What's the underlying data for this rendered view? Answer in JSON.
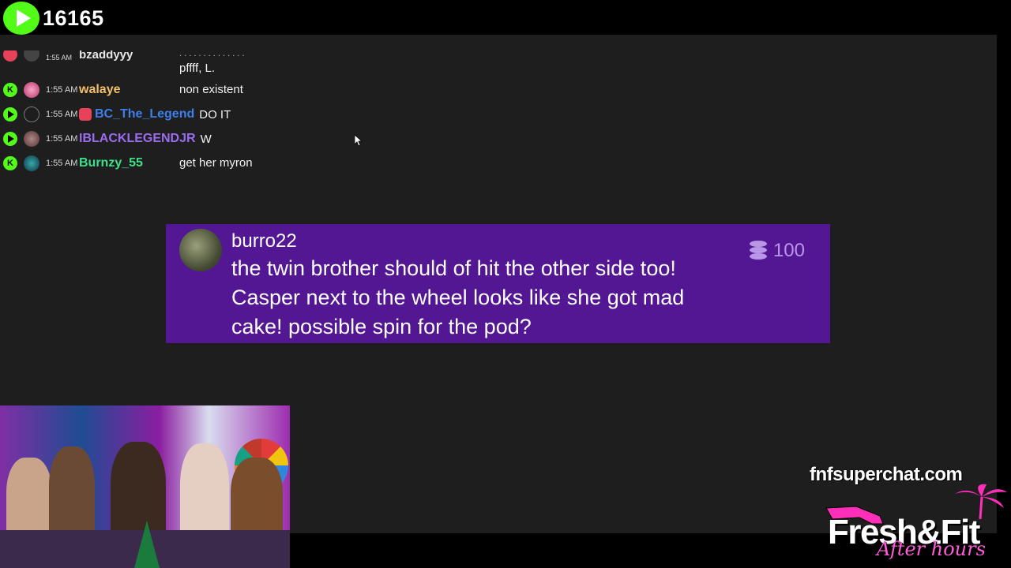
{
  "top_bar": {
    "viewer_count": "16165",
    "brand_color": "#53fc18"
  },
  "chat": {
    "partial_row": {
      "time": "1:55 AM",
      "user": "bzaddyyy",
      "dots": ". . . . . . . . . . . . . .",
      "message": "pffff, L."
    },
    "rows": [
      {
        "platform": "kick-icon",
        "time": "1:55 AM",
        "user": "walaye",
        "user_color": "#f3c067",
        "message": "non existent",
        "has_badge": false
      },
      {
        "platform": "play-icon",
        "time": "1:55 AM",
        "user": "BC_The_Legend",
        "user_color": "#3f7fe9",
        "message": "DO IT",
        "has_badge": true
      },
      {
        "platform": "play-icon",
        "time": "1:55 AM",
        "user": "IBLACKLEGENDJR",
        "user_color": "#9b6cf0",
        "message": "W",
        "has_badge": false
      },
      {
        "platform": "kick-icon",
        "time": "1:55 AM",
        "user": "Burnzy_55",
        "user_color": "#3ee08a",
        "message": "get her myron",
        "has_badge": false
      }
    ]
  },
  "superchat": {
    "username": "burro22",
    "message": "the twin brother should of hit the other side too! Casper next to the wheel looks like she got mad cake! possible spin for the pod?",
    "amount": "100",
    "bg_color": "#531794"
  },
  "branding": {
    "url": "fnfsuperchat.com",
    "logo_main": "Fresh&Fit",
    "logo_sub": "After hours"
  }
}
